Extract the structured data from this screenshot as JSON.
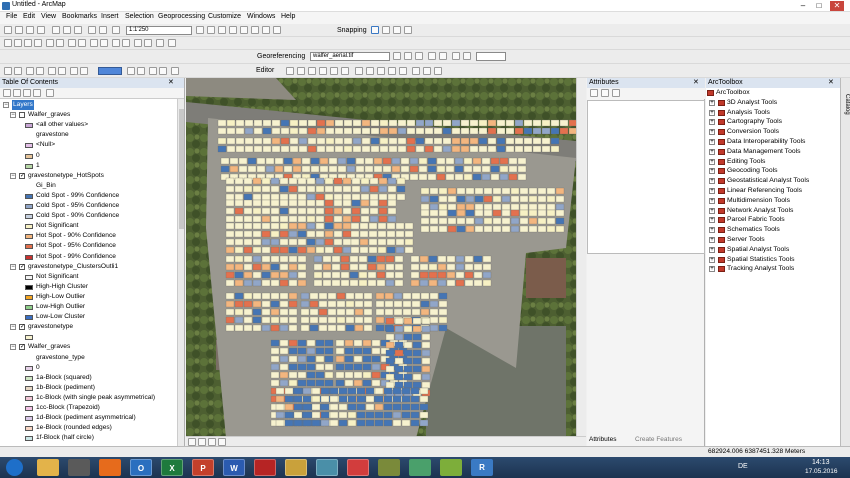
{
  "window": {
    "title": "Untitled - ArcMap"
  },
  "menu": [
    "File",
    "Edit",
    "View",
    "Bookmarks",
    "Insert",
    "Selection",
    "Geoprocessing",
    "Customize",
    "Windows",
    "Help"
  ],
  "toolbar": {
    "scale": "1:1'250",
    "snapping_label": "Snapping",
    "georeferencing_label": "Georeferencing",
    "georef_layer": "walfer_aerial.tif",
    "editor_label": "Editor"
  },
  "toc": {
    "title": "Table Of Contents",
    "root": "Layers",
    "layers": [
      {
        "name": "Walfer_graves",
        "checked": false,
        "items": [
          {
            "label": "<all other values>",
            "color": "#c9a7d6"
          },
          {
            "label": "gravestone",
            "color": null
          },
          {
            "label": "<Null>",
            "color": "#e4c0e8"
          },
          {
            "label": "0",
            "color": "#e7c59b"
          },
          {
            "label": "1",
            "color": "#b8d9a8"
          }
        ]
      },
      {
        "name": "gravestonetype_HotSpots",
        "checked": true,
        "items": [
          {
            "label": "Gi_Bin",
            "color": null
          },
          {
            "label": "Cold Spot - 99% Confidence",
            "color": "#4575b4"
          },
          {
            "label": "Cold Spot - 95% Confidence",
            "color": "#91a6c8"
          },
          {
            "label": "Cold Spot - 90% Confidence",
            "color": "#c6d1e0"
          },
          {
            "label": "Not Significant",
            "color": "#f7f1c4"
          },
          {
            "label": "Hot Spot - 90% Confidence",
            "color": "#f3b67f"
          },
          {
            "label": "Hot Spot - 95% Confidence",
            "color": "#e3714e"
          },
          {
            "label": "Hot Spot - 99% Confidence",
            "color": "#c8312f"
          }
        ]
      },
      {
        "name": "gravestonetype_ClustersOutli1",
        "checked": true,
        "items": [
          {
            "label": "Not Significant",
            "color": "#f2f2f2"
          },
          {
            "label": "High-High Cluster",
            "color": "#000000"
          },
          {
            "label": "High-Low Outlier",
            "color": "#f5a623"
          },
          {
            "label": "Low-High Outlier",
            "color": "#8fcf8a"
          },
          {
            "label": "Low-Low Cluster",
            "color": "#3a6fc4"
          }
        ]
      },
      {
        "name": "gravestonetype",
        "checked": true,
        "items": [
          {
            "label": "",
            "color": "#f7f2cf"
          }
        ]
      },
      {
        "name": "Walfer_graves",
        "checked": true,
        "items": [
          {
            "label": "gravestone_type",
            "color": null
          },
          {
            "label": "0",
            "color": "#e6d2e8"
          },
          {
            "label": "1a-Block (squared)",
            "color": "#cfe6c4"
          },
          {
            "label": "1b-Block (pediment)",
            "color": "#e6d7c4"
          },
          {
            "label": "1c-Block (with single peak asymmetrical)",
            "color": "#f1c6d6"
          },
          {
            "label": "1cc-Block (Trapezoid)",
            "color": "#f3c3e6"
          },
          {
            "label": "1d-Block (pediment asymmetrical)",
            "color": "#d9c8e8"
          },
          {
            "label": "1e-Block (rounded edges)",
            "color": "#f7d6c4"
          },
          {
            "label": "1f-Block (half circle)",
            "color": "#cbe6e6"
          }
        ]
      }
    ]
  },
  "attributes": {
    "title": "Attributes",
    "tab_attributes": "Attributes",
    "tab_create_features": "Create Features"
  },
  "toolbox": {
    "title": "ArcToolbox",
    "items": [
      "3D Analyst Tools",
      "Analysis Tools",
      "Cartography Tools",
      "Conversion Tools",
      "Data Interoperability Tools",
      "Data Management Tools",
      "Editing Tools",
      "Geocoding Tools",
      "Geostatistical Analyst Tools",
      "Linear Referencing Tools",
      "Multidimension Tools",
      "Network Analyst Tools",
      "Parcel Fabric Tools",
      "Schematics Tools",
      "Server Tools",
      "Spatial Analyst Tools",
      "Spatial Statistics Tools",
      "Tracking Analyst Tools"
    ]
  },
  "catalog_tab": "Catalog",
  "status": {
    "coordinates": "682924.006  6387451.328 Meters"
  },
  "taskbar": {
    "time": "14:13",
    "date": "17.05.2016",
    "lang": "DE",
    "apps": [
      {
        "icon": "start-orb-icon",
        "label": ""
      },
      {
        "icon": "explorer-icon",
        "label": ""
      },
      {
        "icon": "media-icon",
        "label": ""
      },
      {
        "icon": "firefox-icon",
        "label": ""
      },
      {
        "icon": "outlook-icon",
        "label": "O"
      },
      {
        "icon": "excel-icon",
        "label": "X"
      },
      {
        "icon": "powerpoint-icon",
        "label": "P"
      },
      {
        "icon": "word-icon",
        "label": "W"
      },
      {
        "icon": "acrobat-icon",
        "label": ""
      },
      {
        "icon": "gis-icon",
        "label": ""
      },
      {
        "icon": "arcmap-icon",
        "label": ""
      },
      {
        "icon": "red-app-icon",
        "label": ""
      },
      {
        "icon": "gear-app-icon",
        "label": ""
      },
      {
        "icon": "globe-app-icon",
        "label": ""
      },
      {
        "icon": "leaf-app-icon",
        "label": ""
      },
      {
        "icon": "r-icon",
        "label": "R"
      }
    ]
  }
}
